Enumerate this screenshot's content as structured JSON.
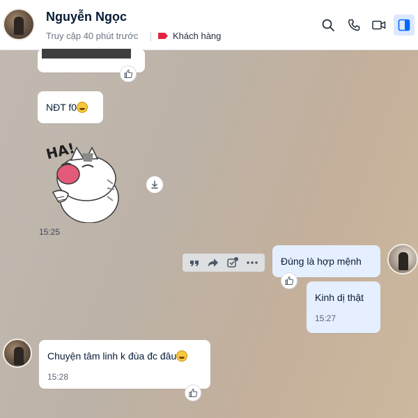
{
  "header": {
    "contact_name": "Nguyễn Ngọc",
    "presence": "Truy cập 40 phút trước",
    "tag_label": "Khách hàng",
    "tag_color": "#e0263f",
    "buttons": [
      "search-icon",
      "phone-icon",
      "video-call-icon",
      "sidebar-toggle-icon"
    ]
  },
  "messages": {
    "nickname_msg": {
      "text": "NĐT f0"
    },
    "sticker": {
      "caption": "HA!",
      "time": "15:25"
    },
    "msg_mine_1": {
      "text": "Đúng là hợp mệnh"
    },
    "msg_mine_2": {
      "text": "Kinh dị thật",
      "time": "15:27"
    },
    "msg_theirs_last": {
      "text": "Chuyện tâm linh k đùa đc đâu",
      "time": "15:28"
    }
  },
  "message_actions": [
    "quote-icon",
    "forward-icon",
    "add-task-icon",
    "more-icon"
  ],
  "colors": {
    "accent": "#0068ff",
    "my_bubble": "#e5efff",
    "their_bubble": "#ffffff"
  }
}
